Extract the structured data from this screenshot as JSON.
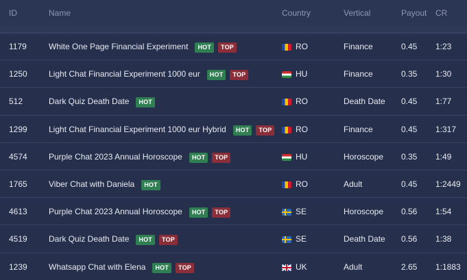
{
  "columns": {
    "id": "ID",
    "name": "Name",
    "country": "Country",
    "vertical": "Vertical",
    "payout": "Payout",
    "cr": "CR"
  },
  "rows": [
    {
      "id": "1179",
      "name": "White One Page Financial Experiment",
      "hot": "HOT",
      "top": "TOP",
      "flag": "ro",
      "country": "RO",
      "vertical": "Finance",
      "payout": "0.45",
      "cr": "1:23"
    },
    {
      "id": "1250",
      "name": "Light Chat Financial Experiment 1000 eur",
      "hot": "HOT",
      "top": "TOP",
      "flag": "hu",
      "country": "HU",
      "vertical": "Finance",
      "payout": "0.35",
      "cr": "1:30"
    },
    {
      "id": "512",
      "name": "Dark Quiz Death Date",
      "hot": "HOT",
      "top": "",
      "flag": "ro",
      "country": "RO",
      "vertical": "Death Date",
      "payout": "0.45",
      "cr": "1:77"
    },
    {
      "id": "1299",
      "name": "Light Chat Financial Experiment 1000 eur Hybrid",
      "hot": "HOT",
      "top": "TOP",
      "flag": "ro",
      "country": "RO",
      "vertical": "Finance",
      "payout": "0.45",
      "cr": "1:317"
    },
    {
      "id": "4574",
      "name": "Purple Chat 2023 Annual Horoscope",
      "hot": "HOT",
      "top": "TOP",
      "flag": "hu",
      "country": "HU",
      "vertical": "Horoscope",
      "payout": "0.35",
      "cr": "1:49"
    },
    {
      "id": "1765",
      "name": "Viber Chat with Daniela",
      "hot": "HOT",
      "top": "",
      "flag": "ro",
      "country": "RO",
      "vertical": "Adult",
      "payout": "0.45",
      "cr": "1:2449"
    },
    {
      "id": "4613",
      "name": "Purple Chat 2023 Annual Horoscope",
      "hot": "HOT",
      "top": "TOP",
      "flag": "se",
      "country": "SE",
      "vertical": "Horoscope",
      "payout": "0.56",
      "cr": "1:54"
    },
    {
      "id": "4519",
      "name": "Dark Quiz Death Date",
      "hot": "HOT",
      "top": "TOP",
      "flag": "se",
      "country": "SE",
      "vertical": "Death Date",
      "payout": "0.56",
      "cr": "1:38"
    },
    {
      "id": "1239",
      "name": "Whatsapp Chat with Elena",
      "hot": "HOT",
      "top": "TOP",
      "flag": "uk",
      "country": "UK",
      "vertical": "Adult",
      "payout": "2.65",
      "cr": "1:1883"
    }
  ]
}
